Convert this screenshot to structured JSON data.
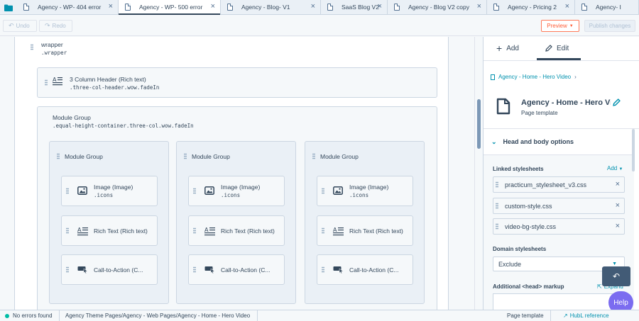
{
  "tabs": [
    {
      "label": "Agency - WP- 404 error",
      "active": false
    },
    {
      "label": "Agency - WP- 500 error",
      "active": true
    },
    {
      "label": "Agency - Blog- V1",
      "active": false
    },
    {
      "label": "SaaS Blog V2",
      "active": false
    },
    {
      "label": "Agency - Blog V2 copy",
      "active": false
    },
    {
      "label": "Agency - Pricing 2",
      "active": false
    },
    {
      "label": "Agency- I",
      "active": false
    }
  ],
  "toolbar": {
    "undo_label": "Undo",
    "redo_label": "Redo",
    "preview_label": "Preview",
    "publish_label": "Publish changes"
  },
  "canvas": {
    "wrapper": {
      "name": "wrapper",
      "cls": ".wrapper"
    },
    "header_module": {
      "name": "3 Column Header (Rich text)",
      "cls": ".three-col-header.wow.fadeIn"
    },
    "module_group": {
      "name": "Module Group",
      "cls": ".equal-height-container.three-col.wow.fadeIn"
    },
    "columns": [
      {
        "name": "Module Group",
        "modules": [
          {
            "name": "Image (Image)",
            "cls": ".icons",
            "icon": "image-icon"
          },
          {
            "name": "Rich Text (Rich text)",
            "cls": "",
            "icon": "rich-text-icon"
          },
          {
            "name": "Call-to-Action (C...",
            "cls": "",
            "icon": "cta-icon"
          }
        ]
      },
      {
        "name": "Module Group",
        "modules": [
          {
            "name": "Image (Image)",
            "cls": ".icons",
            "icon": "image-icon"
          },
          {
            "name": "Rich Text (Rich text)",
            "cls": "",
            "icon": "rich-text-icon"
          },
          {
            "name": "Call-to-Action (C...",
            "cls": "",
            "icon": "cta-icon"
          }
        ]
      },
      {
        "name": "Module Group",
        "modules": [
          {
            "name": "Image (Image)",
            "cls": ".icons",
            "icon": "image-icon"
          },
          {
            "name": "Rich Text (Rich text)",
            "cls": "",
            "icon": "rich-text-icon"
          },
          {
            "name": "Call-to-Action (C...",
            "cls": "",
            "icon": "cta-icon"
          }
        ]
      }
    ]
  },
  "sidebar": {
    "tabs": {
      "add_label": "Add",
      "edit_label": "Edit"
    },
    "breadcrumb": "Agency - Home - Hero Video",
    "template_title": "Agency - Home - Hero Vi",
    "template_type": "Page template",
    "section_title": "Head and body options",
    "linked_label": "Linked stylesheets",
    "add_link": "Add",
    "stylesheets": [
      "practicum_stylesheet_v3.css",
      "custom-style.css",
      "video-bg-style.css"
    ],
    "domain_label": "Domain stylesheets",
    "domain_value": "Exclude",
    "markup_label": "Additional <head> markup",
    "expand_label": "Expand"
  },
  "status": {
    "errors": "No errors found",
    "path": "Agency Theme Pages/Agency - Web Pages/Agency - Home - Hero Video",
    "type": "Page template",
    "hubl": "HubL reference"
  },
  "help_label": "Help",
  "colors": {
    "accent": "#ff7a59",
    "link": "#0091ae",
    "text": "#33475b",
    "help": "#7b6cf0",
    "ok": "#00bda5"
  }
}
